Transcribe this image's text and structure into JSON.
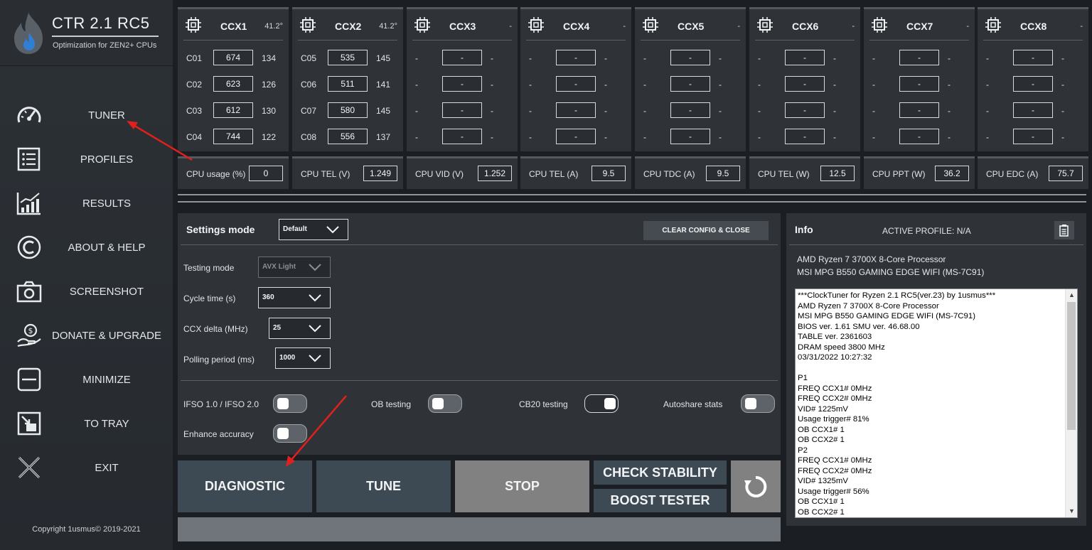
{
  "app": {
    "title": "CTR 2.1 RC5",
    "subtitle": "Optimization for ZEN2+ CPUs",
    "copyright": "Copyright 1usmus© 2019-2021"
  },
  "nav": [
    {
      "label": "TUNER",
      "icon": "speedometer-icon"
    },
    {
      "label": "PROFILES",
      "icon": "list-icon"
    },
    {
      "label": "RESULTS",
      "icon": "bar-chart-icon"
    },
    {
      "label": "ABOUT & HELP",
      "icon": "copyright-icon"
    },
    {
      "label": "SCREENSHOT",
      "icon": "camera-icon"
    },
    {
      "label": "DONATE & UPGRADE",
      "icon": "donate-hand-icon"
    },
    {
      "label": "MINIMIZE",
      "icon": "minimize-icon"
    },
    {
      "label": "TO TRAY",
      "icon": "tray-icon"
    },
    {
      "label": "EXIT",
      "icon": "exit-x-icon"
    }
  ],
  "ccx": [
    {
      "name": "CCX1",
      "temp": "41.2°",
      "cores": [
        {
          "id": "C01",
          "freq": "674",
          "val": "134"
        },
        {
          "id": "C02",
          "freq": "623",
          "val": "126"
        },
        {
          "id": "C03",
          "freq": "612",
          "val": "130"
        },
        {
          "id": "C04",
          "freq": "744",
          "val": "122"
        }
      ]
    },
    {
      "name": "CCX2",
      "temp": "41.2°",
      "cores": [
        {
          "id": "C05",
          "freq": "535",
          "val": "145"
        },
        {
          "id": "C06",
          "freq": "511",
          "val": "141"
        },
        {
          "id": "C07",
          "freq": "580",
          "val": "145"
        },
        {
          "id": "C08",
          "freq": "556",
          "val": "137"
        }
      ]
    },
    {
      "name": "CCX3",
      "temp": "-",
      "cores": [
        {
          "id": "-",
          "freq": "-",
          "val": "-"
        },
        {
          "id": "-",
          "freq": "-",
          "val": "-"
        },
        {
          "id": "-",
          "freq": "-",
          "val": "-"
        },
        {
          "id": "-",
          "freq": "-",
          "val": "-"
        }
      ]
    },
    {
      "name": "CCX4",
      "temp": "-",
      "cores": [
        {
          "id": "-",
          "freq": "-",
          "val": "-"
        },
        {
          "id": "-",
          "freq": "-",
          "val": "-"
        },
        {
          "id": "-",
          "freq": "-",
          "val": "-"
        },
        {
          "id": "-",
          "freq": "-",
          "val": "-"
        }
      ]
    },
    {
      "name": "CCX5",
      "temp": "-",
      "cores": [
        {
          "id": "-",
          "freq": "-",
          "val": "-"
        },
        {
          "id": "-",
          "freq": "-",
          "val": "-"
        },
        {
          "id": "-",
          "freq": "-",
          "val": "-"
        },
        {
          "id": "-",
          "freq": "-",
          "val": "-"
        }
      ]
    },
    {
      "name": "CCX6",
      "temp": "-",
      "cores": [
        {
          "id": "-",
          "freq": "-",
          "val": "-"
        },
        {
          "id": "-",
          "freq": "-",
          "val": "-"
        },
        {
          "id": "-",
          "freq": "-",
          "val": "-"
        },
        {
          "id": "-",
          "freq": "-",
          "val": "-"
        }
      ]
    },
    {
      "name": "CCX7",
      "temp": "-",
      "cores": [
        {
          "id": "-",
          "freq": "-",
          "val": "-"
        },
        {
          "id": "-",
          "freq": "-",
          "val": "-"
        },
        {
          "id": "-",
          "freq": "-",
          "val": "-"
        },
        {
          "id": "-",
          "freq": "-",
          "val": "-"
        }
      ]
    },
    {
      "name": "CCX8",
      "temp": "-",
      "cores": [
        {
          "id": "-",
          "freq": "-",
          "val": "-"
        },
        {
          "id": "-",
          "freq": "-",
          "val": "-"
        },
        {
          "id": "-",
          "freq": "-",
          "val": "-"
        },
        {
          "id": "-",
          "freq": "-",
          "val": "-"
        }
      ]
    }
  ],
  "metrics": [
    {
      "label": "CPU usage (%)",
      "value": "0"
    },
    {
      "label": "CPU TEL (V)",
      "value": "1.249"
    },
    {
      "label": "CPU VID (V)",
      "value": "1.252"
    },
    {
      "label": "CPU TEL (A)",
      "value": "9.5"
    },
    {
      "label": "CPU TDC (A)",
      "value": "9.5"
    },
    {
      "label": "CPU TEL (W)",
      "value": "12.5"
    },
    {
      "label": "CPU PPT (W)",
      "value": "36.2"
    },
    {
      "label": "CPU EDC (A)",
      "value": "75.7"
    }
  ],
  "settings": {
    "title": "Settings mode",
    "mode_value": "Default",
    "clear_label": "CLEAR CONFIG & CLOSE",
    "fields": [
      {
        "label": "Testing mode",
        "value": "AVX Light",
        "disabled": true
      },
      {
        "label": "Cycle time (s)",
        "value": "360"
      },
      {
        "label": "CCX delta (MHz)",
        "value": "25"
      },
      {
        "label": "Polling period (ms)",
        "value": "1000"
      }
    ],
    "toggles": [
      {
        "label": "IFSO 1.0 / IFSO 2.0",
        "on": false
      },
      {
        "label": "OB testing",
        "on": false
      },
      {
        "label": "CB20 testing",
        "on": true
      },
      {
        "label": "Autoshare stats",
        "on": false
      },
      {
        "label": "Enhance accuracy",
        "on": false
      }
    ]
  },
  "buttons": {
    "diagnostic": "DIAGNOSTIC",
    "tune": "TUNE",
    "stop": "STOP",
    "check_stability": "CHECK STABILITY",
    "boost_tester": "BOOST TESTER"
  },
  "info": {
    "title": "Info",
    "active_profile": "ACTIVE PROFILE: N/A",
    "cpu": "AMD Ryzen 7 3700X 8-Core Processor",
    "motherboard": "MSI MPG B550 GAMING EDGE WIFI (MS-7C91)",
    "log": [
      "***ClockTuner for Ryzen 2.1 RC5(ver.23) by 1usmus***",
      "AMD Ryzen 7 3700X 8-Core Processor",
      "MSI MPG B550 GAMING EDGE WIFI (MS-7C91)",
      "BIOS ver. 1.61 SMU ver. 46.68.00",
      "TABLE ver. 2361603",
      "DRAM speed 3800 MHz",
      "03/31/2022 10:27:32",
      "",
      "P1",
      "FREQ CCX1# 0MHz",
      "FREQ CCX2# 0MHz",
      "VID# 1225mV",
      "Usage trigger# 81%",
      "OB CCX1# 1",
      "OB CCX2# 1",
      "P2",
      "FREQ CCX1# 0MHz",
      "FREQ CCX2# 0MHz",
      "VID# 1325mV",
      "Usage trigger# 56%",
      "OB CCX1# 1",
      "OB CCX2# 1"
    ]
  },
  "colors": {
    "annotation_arrow": "#e0201c",
    "panel": "#2f3338",
    "sidebar": "#2a2e33",
    "button": "#3e4a53",
    "button_disabled": "#818181"
  }
}
